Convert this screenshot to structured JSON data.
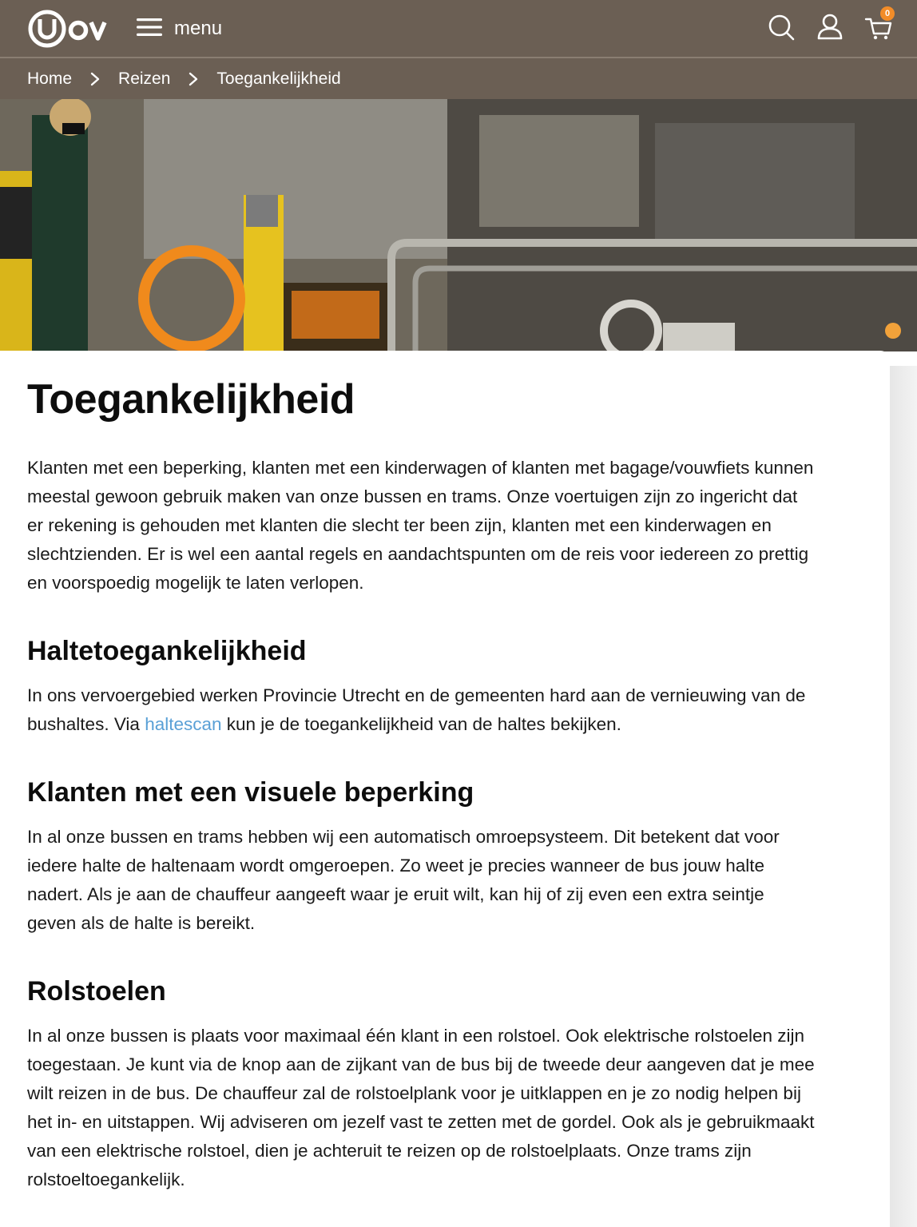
{
  "header": {
    "brand": "U-OV",
    "menu_label": "menu",
    "cart_count": "0"
  },
  "breadcrumb": {
    "items": [
      "Home",
      "Reizen"
    ],
    "current": "Toegankelijkheid"
  },
  "hero": {
    "alt": "Reizigster bij tram en bus"
  },
  "content": {
    "title": "Toegankelijkheid",
    "intro": "Klanten met een beperking, klanten met een kinderwagen of klanten met bagage/vouwfiets kunnen meestal gewoon gebruik maken van onze bussen en trams. Onze voertuigen zijn zo ingericht dat er rekening is gehouden met klanten die slecht ter been zijn, klanten met een kinderwagen en slechtzienden. Er is wel een aantal regels en aandachtspunten om de reis voor iedereen zo prettig en voorspoedig mogelijk te laten verlopen.",
    "sections": [
      {
        "heading": "Haltetoegankelijkheid",
        "text_before": "In ons vervoergebied werken Provincie Utrecht en de gemeenten hard aan de vernieuwing van de bushaltes. Via ",
        "link": "haltescan",
        "text_after": " kun je de toegankelijkheid van de haltes bekijken."
      },
      {
        "heading": "Klanten met een visuele beperking",
        "text": "In al onze bussen en trams hebben wij een automatisch omroepsysteem. Dit betekent dat voor iedere halte de haltenaam wordt omgeroepen. Zo weet je precies wanneer de bus jouw halte nadert. Als je aan de chauffeur aangeeft waar je eruit wilt, kan hij of zij even een extra seintje geven als de halte is bereikt."
      },
      {
        "heading": "Rolstoelen",
        "text": "In al onze bussen is plaats voor maximaal één klant in een rolstoel. Ook elektrische rolstoelen zijn toegestaan. Je kunt via de knop aan de zijkant van de bus bij de tweede deur aangeven dat je mee wilt reizen in de bus. De chauffeur zal de rolstoelplank voor je uitklappen en je zo nodig helpen bij het in- en uitstappen. Wij adviseren om jezelf vast te zetten met de gordel. Ook als je gebruikmaakt van een elektrische rolstoel, dien je achteruit te reizen op de rolstoelplaats. Onze trams zijn rolstoeltoegankelijk."
      }
    ]
  },
  "colors": {
    "header_bg": "#6b5f54",
    "accent_orange": "#f28c28",
    "link": "#5aa0d6"
  },
  "icons": [
    "logo-icon",
    "hamburger-icon",
    "search-icon",
    "account-icon",
    "cart-icon",
    "chevron-right-icon"
  ]
}
